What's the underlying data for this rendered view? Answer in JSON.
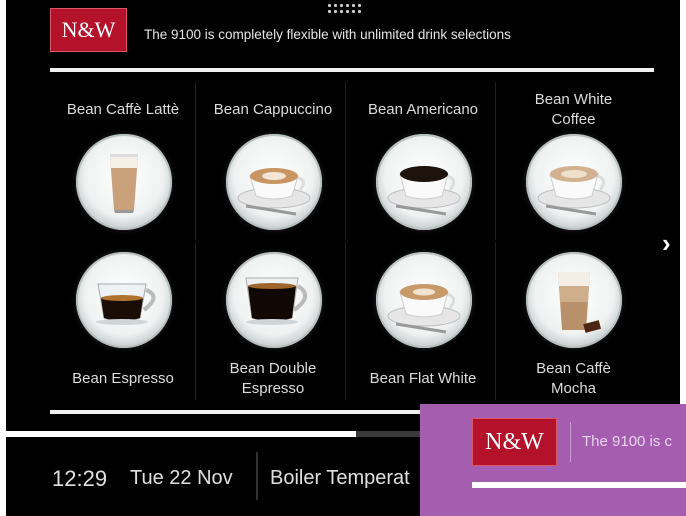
{
  "header": {
    "brand": "N&W",
    "tagline": "The 9100 is completely flexible with unlimited drink selections"
  },
  "drinks": [
    {
      "label": "Bean Caffè Lattè",
      "icon": "latte-glass-icon"
    },
    {
      "label": "Bean Cappuccino",
      "icon": "cappuccino-cup-icon"
    },
    {
      "label": "Bean Americano",
      "icon": "americano-cup-icon"
    },
    {
      "label": "Bean White\nCoffee",
      "icon": "white-coffee-cup-icon"
    },
    {
      "label": "Bean Espresso",
      "icon": "espresso-glass-cup-icon"
    },
    {
      "label": "Bean Double\nEspresso",
      "icon": "double-espresso-cup-icon"
    },
    {
      "label": "Bean Flat White",
      "icon": "flat-white-cup-icon"
    },
    {
      "label": "Bean Caffè\nMocha",
      "icon": "mocha-glass-icon"
    }
  ],
  "navigation": {
    "next_icon": "chevron-right-icon",
    "next_glyph": "›"
  },
  "status_bar": {
    "time": "12:29",
    "date": "Tue 22 Nov",
    "boiler": "Boiler Temperat",
    "progress_fraction": 0.52
  },
  "overlay": {
    "brand": "N&W",
    "tagline": "The 9100 is c"
  },
  "colors": {
    "brand_red": "#b3122a",
    "overlay_purple": "#a55db0",
    "background": "#000000"
  }
}
